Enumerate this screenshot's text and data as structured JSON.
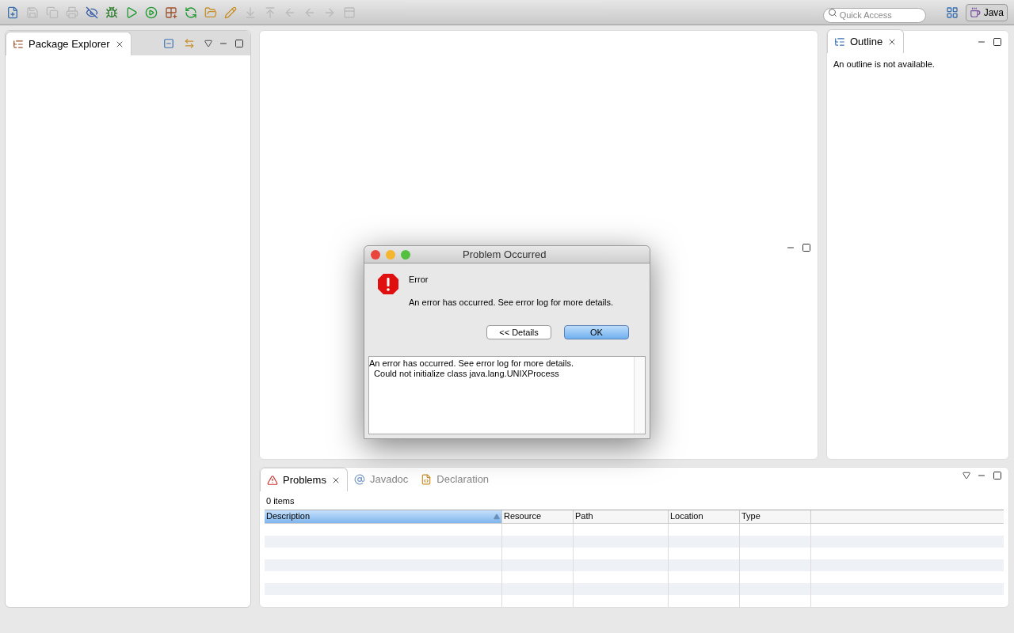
{
  "toolbar": {
    "search": {
      "placeholder": "Quick Access"
    },
    "perspective": {
      "label": "Java",
      "selected": true
    }
  },
  "package_explorer": {
    "tabs": [
      {
        "label": "Package Explorer",
        "selected": true
      }
    ]
  },
  "outline": {
    "tabs": [
      {
        "label": "Outline",
        "selected": true
      }
    ],
    "message": "An outline is not available."
  },
  "bottom_panel": {
    "tabs": [
      {
        "label": "Problems",
        "selected": true,
        "kind": "problems"
      },
      {
        "label": "Javadoc",
        "selected": false,
        "kind": "javadoc"
      },
      {
        "label": "Declaration",
        "selected": false,
        "kind": "declaration"
      }
    ],
    "count": "0 items",
    "columns": [
      {
        "label": "Description",
        "selected": true
      },
      {
        "label": "Resource",
        "selected": false
      },
      {
        "label": "Path",
        "selected": false
      },
      {
        "label": "Location",
        "selected": false
      },
      {
        "label": "Type",
        "selected": false
      }
    ]
  },
  "dialog": {
    "title": "Problem Occurred",
    "heading": "Error",
    "message": "An error has occurred. See error log for more details.",
    "buttons": [
      {
        "label": "<< Details",
        "selected": false
      },
      {
        "label": "OK",
        "selected": true
      }
    ],
    "details": [
      "An error has occurred. See error log for more details.",
      "  Could not initialize class java.lang.UNIXProcess"
    ]
  }
}
